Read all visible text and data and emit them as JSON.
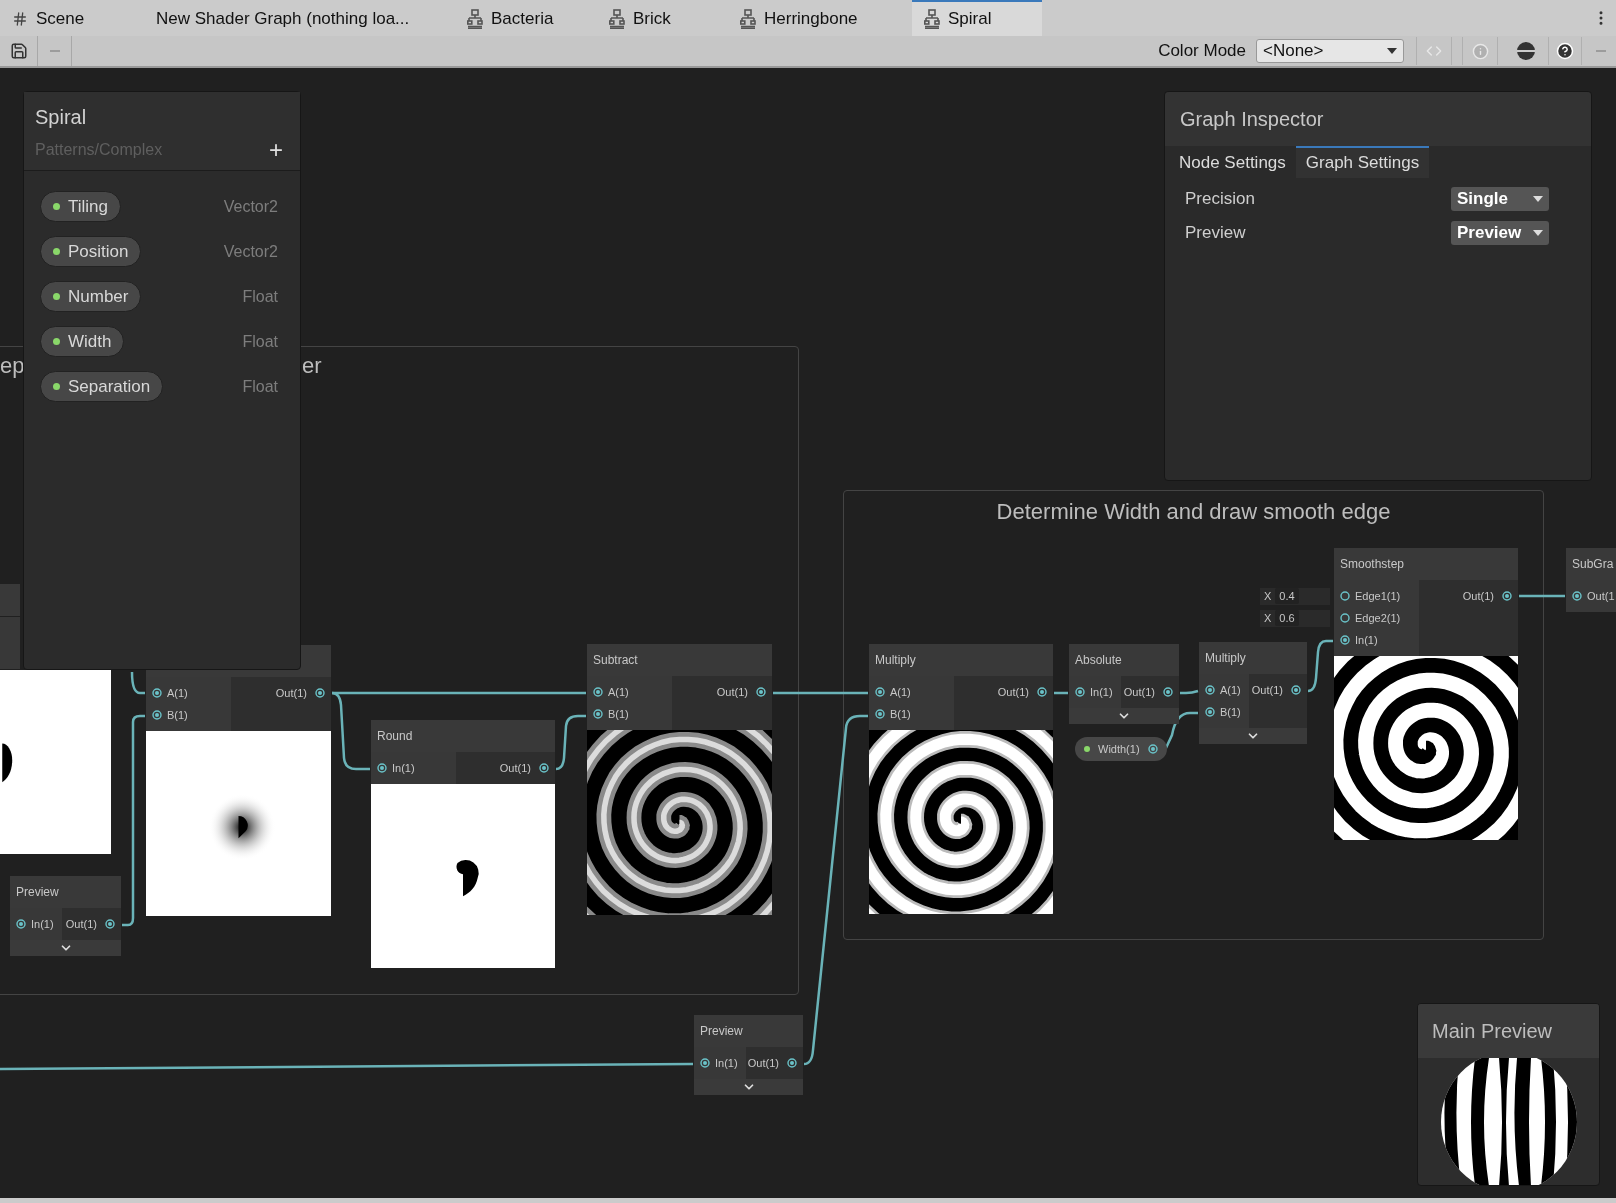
{
  "tabs": [
    {
      "label": "Scene",
      "kind": "scene",
      "selected": false
    },
    {
      "label": "New Shader Graph (nothing loa...",
      "kind": "plain",
      "selected": false
    },
    {
      "label": "Bacteria",
      "kind": "graph",
      "selected": false
    },
    {
      "label": "Brick",
      "kind": "graph",
      "selected": false
    },
    {
      "label": "Herringbone",
      "kind": "graph",
      "selected": false
    },
    {
      "label": "Spiral",
      "kind": "graph",
      "selected": true
    }
  ],
  "toolbar": {
    "color_mode_label": "Color Mode",
    "color_mode_value": "<None>"
  },
  "blackboard": {
    "title": "Spiral",
    "subtitle": "Patterns/Complex",
    "add": "+",
    "properties": [
      {
        "name": "Tiling",
        "type": "Vector2"
      },
      {
        "name": "Position",
        "type": "Vector2"
      },
      {
        "name": "Number",
        "type": "Float"
      },
      {
        "name": "Width",
        "type": "Float"
      },
      {
        "name": "Separation",
        "type": "Float"
      }
    ]
  },
  "inspector": {
    "title": "Graph Inspector",
    "tabs": [
      {
        "label": "Node Settings",
        "selected": false
      },
      {
        "label": "Graph Settings",
        "selected": true
      }
    ],
    "settings": [
      {
        "label": "Precision",
        "value": "Single"
      },
      {
        "label": "Preview",
        "value": "Preview"
      }
    ]
  },
  "groups": [
    {
      "title_fragments": [
        "ep",
        "er"
      ]
    },
    {
      "title_fragments": [
        "Determine Width and draw smooth edge"
      ]
    }
  ],
  "nodes": [
    {
      "inputs": [
        {
          "label": "A(1)"
        },
        {
          "label": "B(1)"
        }
      ],
      "outputs": [
        "Out(1)"
      ],
      "preview": true,
      "collapsible": false
    },
    {
      "title": "Preview",
      "inputs": [
        {
          "label": "In(1)"
        }
      ],
      "outputs": [
        "Out(1)"
      ],
      "preview": false,
      "collapsible": true
    },
    {
      "title": "Round",
      "inputs": [
        {
          "label": "In(1)"
        }
      ],
      "outputs": [
        "Out(1)"
      ],
      "preview": true,
      "collapsible": false
    },
    {
      "title": "Subtract",
      "inputs": [
        {
          "label": "A(1)"
        },
        {
          "label": "B(1)"
        }
      ],
      "outputs": [
        "Out(1)"
      ],
      "preview": true,
      "collapsible": false
    },
    {
      "title": "Multiply",
      "inputs": [
        {
          "label": "A(1)"
        },
        {
          "label": "B(1)"
        }
      ],
      "outputs": [
        "Out(1)"
      ],
      "preview": true,
      "collapsible": false
    },
    {
      "title": "Absolute",
      "inputs": [
        {
          "label": "In(1)"
        }
      ],
      "outputs": [
        "Out(1)"
      ],
      "preview": false,
      "collapsible": true
    },
    {
      "title": "Multiply",
      "inputs": [
        {
          "label": "A(1)"
        },
        {
          "label": "B(1)"
        }
      ],
      "outputs": [
        "Out(1)"
      ],
      "preview": false,
      "collapsible": true
    },
    {
      "title": "Smoothstep",
      "inputs": [
        {
          "label": "Edge1(1)",
          "axis": "X",
          "value": "0.4"
        },
        {
          "label": "Edge2(1)",
          "axis": "X",
          "value": "0.6"
        },
        {
          "label": "In(1)"
        }
      ],
      "outputs": [
        "Out(1)"
      ],
      "preview": true,
      "collapsible": false
    },
    {
      "title": "SubGra",
      "inputs": [
        {
          "label": "Out(1"
        }
      ],
      "preview": false,
      "collapsible": false
    },
    {
      "title": "Preview",
      "inputs": [
        {
          "label": "In(1)"
        }
      ],
      "outputs": [
        "Out(1)"
      ],
      "preview": false,
      "collapsible": true
    }
  ],
  "property_node": {
    "label": "Width(1)"
  },
  "main_preview": {
    "title": "Main Preview"
  }
}
